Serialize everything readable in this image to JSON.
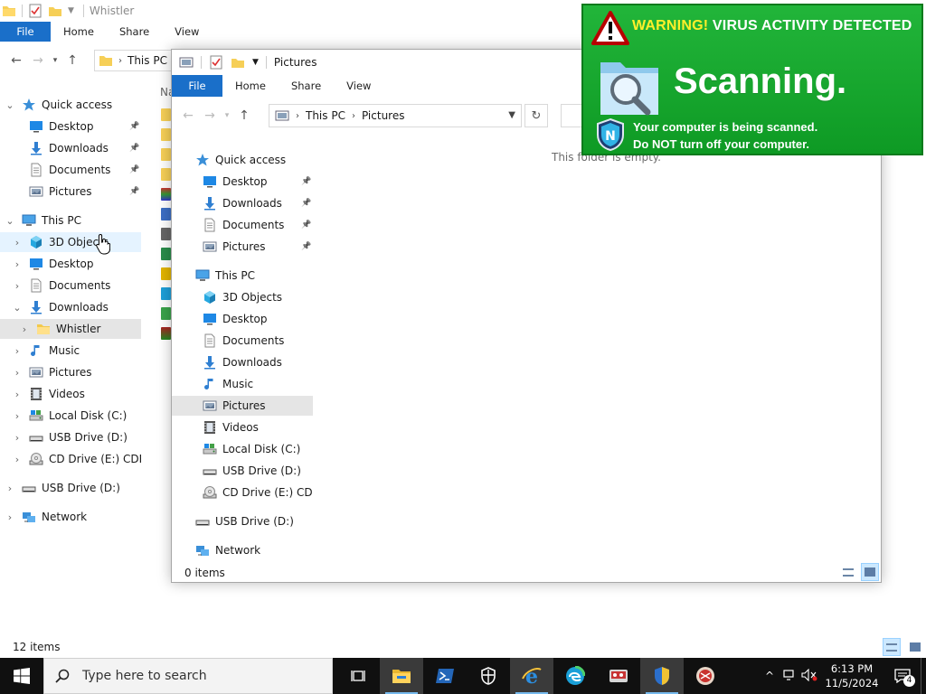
{
  "bg_window": {
    "title": "Whistler",
    "tabs": [
      "File",
      "Home",
      "Share",
      "View"
    ],
    "crumb": "This PC",
    "name_header": "Na",
    "status": "12 items",
    "tree": [
      {
        "label": "Quick access",
        "icon": "star-icon"
      },
      {
        "label": "Desktop",
        "icon": "desktop-icon"
      },
      {
        "label": "Downloads",
        "icon": "download-icon"
      },
      {
        "label": "Documents",
        "icon": "document-icon"
      },
      {
        "label": "Pictures",
        "icon": "pictures-icon"
      },
      {
        "label": "This PC",
        "icon": "pc-icon"
      },
      {
        "label": "3D Objects",
        "icon": "cube-icon"
      },
      {
        "label": "Desktop",
        "icon": "desktop-icon"
      },
      {
        "label": "Documents",
        "icon": "document-icon"
      },
      {
        "label": "Downloads",
        "icon": "download-icon"
      },
      {
        "label": "Whistler",
        "icon": "folder-icon"
      },
      {
        "label": "Music",
        "icon": "music-icon"
      },
      {
        "label": "Pictures",
        "icon": "pictures-icon"
      },
      {
        "label": "Videos",
        "icon": "video-icon"
      },
      {
        "label": "Local Disk (C:)",
        "icon": "disk-icon"
      },
      {
        "label": "USB Drive (D:)",
        "icon": "usb-icon"
      },
      {
        "label": "CD Drive (E:) CDROI",
        "icon": "cd-icon"
      },
      {
        "label": "USB Drive (D:)",
        "icon": "usb-icon"
      },
      {
        "label": "Network",
        "icon": "network-icon"
      }
    ]
  },
  "fg_window": {
    "title": "Pictures",
    "tabs": [
      "File",
      "Home",
      "Share",
      "View"
    ],
    "breadcrumb": [
      "This PC",
      "Pictures"
    ],
    "empty_text": "This folder is empty.",
    "status": "0 items",
    "tree": [
      {
        "label": "Quick access",
        "icon": "star-icon"
      },
      {
        "label": "Desktop",
        "icon": "desktop-icon"
      },
      {
        "label": "Downloads",
        "icon": "download-icon"
      },
      {
        "label": "Documents",
        "icon": "document-icon"
      },
      {
        "label": "Pictures",
        "icon": "pictures-icon"
      },
      {
        "label": "This PC",
        "icon": "pc-icon"
      },
      {
        "label": "3D Objects",
        "icon": "cube-icon"
      },
      {
        "label": "Desktop",
        "icon": "desktop-icon"
      },
      {
        "label": "Documents",
        "icon": "document-icon"
      },
      {
        "label": "Downloads",
        "icon": "download-icon"
      },
      {
        "label": "Music",
        "icon": "music-icon"
      },
      {
        "label": "Pictures",
        "icon": "pictures-icon"
      },
      {
        "label": "Videos",
        "icon": "video-icon"
      },
      {
        "label": "Local Disk (C:)",
        "icon": "disk-icon"
      },
      {
        "label": "USB Drive (D:)",
        "icon": "usb-icon"
      },
      {
        "label": "CD Drive (E:) CDROI",
        "icon": "cd-icon"
      },
      {
        "label": "USB Drive (D:)",
        "icon": "usb-icon"
      },
      {
        "label": "Network",
        "icon": "network-icon"
      }
    ]
  },
  "popup": {
    "warning_prefix": "WARNING!",
    "warning_text": "VIRUS ACTIVITY DETECTED",
    "headline": "Scanning.",
    "line1": "Your computer is being scanned.",
    "line2_pre": "Do ",
    "line2_not": "NOT",
    "line2_post": " turn off your computer.",
    "colors": {
      "background": "#1aab30",
      "warning": "#ffef2a"
    }
  },
  "taskbar": {
    "search_placeholder": "Type here to search",
    "time": "6:13 PM",
    "date": "11/5/2024",
    "notification_count": "4",
    "apps": [
      "task-view-icon",
      "file-explorer-icon",
      "powershell-icon",
      "security-icon",
      "internet-explorer-icon",
      "edge-icon",
      "app-icon",
      "shield-admin-icon",
      "app-red-icon"
    ]
  }
}
